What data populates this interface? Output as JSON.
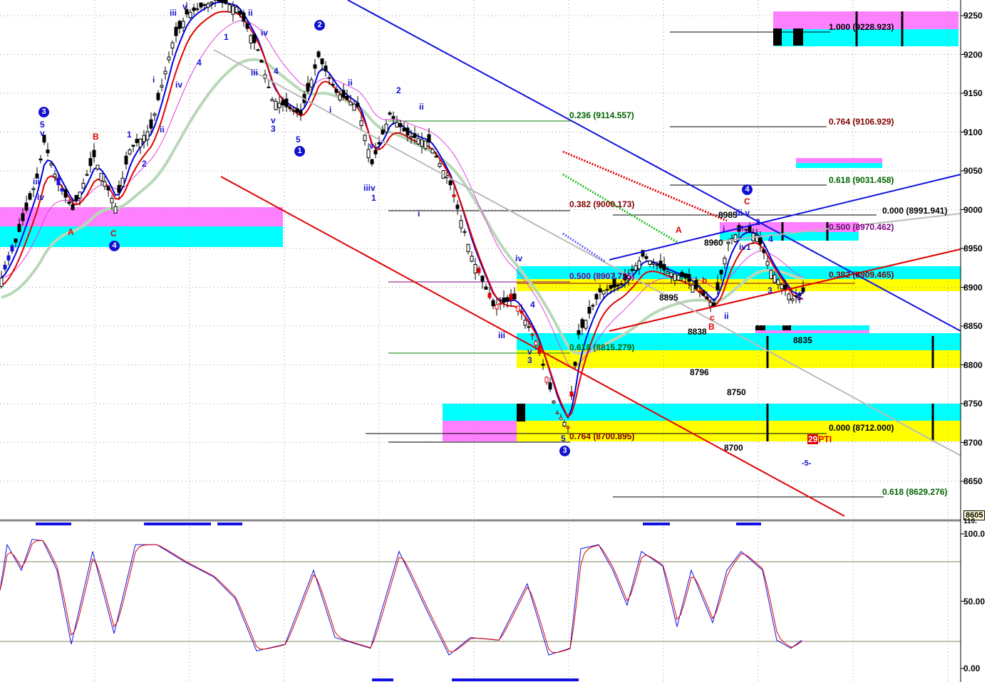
{
  "chart_data": [
    {
      "type": "line",
      "title": "Price (candlestick with Elliott wave counts and Fibonacci levels)",
      "ylim": [
        8605,
        9270
      ],
      "yticks": [
        "9250",
        "9200",
        "9150",
        "9100",
        "9050",
        "9000",
        "8950",
        "8900",
        "8850",
        "8800",
        "8750",
        "8700",
        "8650"
      ],
      "last_axis_label": "8605",
      "price": {
        "bar": [
          0,
          4,
          10,
          12,
          16,
          20,
          26,
          32,
          36,
          42,
          48,
          52,
          60,
          66,
          72,
          76,
          84,
          89,
          94,
          100,
          104,
          109,
          114,
          120,
          126,
          132,
          138,
          144,
          150,
          156,
          159,
          162,
          168,
          174,
          180,
          186,
          192,
          200,
          204,
          208,
          212,
          216,
          222,
          225
        ],
        "close": [
          8912,
          8958,
          9041,
          9087,
          9032,
          9000,
          9068,
          9004,
          9077,
          9105,
          9215,
          9252,
          9270,
          9261,
          9206,
          9142,
          9123,
          9197,
          9151,
          9133,
          9059,
          9123,
          9096,
          9087,
          9032,
          8940,
          8876,
          8885,
          8830,
          8738,
          8720,
          8839,
          8894,
          8903,
          8940,
          8922,
          8912,
          8876,
          8958,
          8977,
          8967,
          8922,
          8885,
          8894
        ]
      },
      "fib_levels": [
        {
          "text": "1.000 (9228.923)",
          "color": "#000000"
        },
        {
          "text": "0.764 (9106.929)",
          "color": "#800000"
        },
        {
          "text": "0.618 (9031.458)",
          "color": "#006400"
        },
        {
          "text": "0.000 (8991.941)",
          "color": "#000000"
        },
        {
          "text": "0.500 (8970.462)",
          "color": "#800080"
        },
        {
          "text": "0.382 (8909.465)",
          "color": "#800000"
        },
        {
          "text": "0.000 (8712.000)",
          "color": "#000000"
        },
        {
          "text": "0.618 (8629.276)",
          "color": "#006400"
        },
        {
          "text": "0.236 (9114.557)",
          "color": "#006400"
        },
        {
          "text": "0.382 (9000.173)",
          "color": "#800000"
        },
        {
          "text": "0.500 (8907.725)",
          "color": "#800080"
        },
        {
          "text": "0.618 (8815.279)",
          "color": "#006400"
        },
        {
          "text": "0.764 (8700.895)",
          "color": "#800000"
        }
      ],
      "price_labels": [
        "8985",
        "8960",
        "8895",
        "8838",
        "8835",
        "8796",
        "8750",
        "8700"
      ],
      "pti": {
        "value": "29",
        "label": "PTI"
      },
      "marker": "-5-"
    },
    {
      "type": "line",
      "title": "Stochastic oscillator",
      "ylim": [
        0,
        110
      ],
      "yticks": [
        "100.0",
        "50.00",
        "0.00"
      ],
      "top_label": "110.",
      "x": [
        0,
        2,
        6,
        9,
        12,
        16,
        20,
        26,
        32,
        38,
        44,
        52,
        60,
        66,
        72,
        80,
        88,
        94,
        104,
        112,
        120,
        126,
        132,
        140,
        148,
        154,
        160,
        163,
        168,
        172,
        176,
        180,
        186,
        190,
        194,
        200,
        204,
        208,
        214,
        218,
        222,
        225
      ],
      "k": [
        58,
        92,
        73,
        96,
        95,
        73,
        18,
        87,
        26,
        92,
        92,
        79,
        68,
        52,
        13,
        18,
        73,
        23,
        15,
        87,
        42,
        10,
        23,
        21,
        63,
        10,
        15,
        89,
        92,
        73,
        47,
        87,
        76,
        31,
        73,
        34,
        73,
        87,
        73,
        21,
        15,
        21
      ],
      "levels": [
        80,
        20
      ]
    }
  ],
  "wave_labels": [
    {
      "t": "3",
      "c": "circle"
    },
    {
      "t": "5",
      "c": "#1010d0"
    },
    {
      "t": "v",
      "c": "#1010d0"
    },
    {
      "t": "iii",
      "c": "#1010d0"
    },
    {
      "t": "iv",
      "c": "#1010d0"
    },
    {
      "t": "A",
      "c": "#e00000"
    },
    {
      "t": "B",
      "c": "#e00000"
    },
    {
      "t": "C",
      "c": "#e00000"
    },
    {
      "t": "4",
      "c": "circle"
    },
    {
      "t": "1",
      "c": "#1010d0"
    },
    {
      "t": "2",
      "c": "#1010d0"
    },
    {
      "t": "ii",
      "c": "#1010d0"
    },
    {
      "t": "i",
      "c": "#1010d0"
    },
    {
      "t": "iv",
      "c": "#1010d0"
    },
    {
      "t": "iii",
      "c": "#1010d0"
    },
    {
      "t": "v",
      "c": "#1010d0"
    },
    {
      "t": "4",
      "c": "#1010d0"
    },
    {
      "t": "1",
      "c": "#1010d0"
    },
    {
      "t": "ii",
      "c": "#1010d0"
    },
    {
      "t": "iv",
      "c": "#1010d0"
    },
    {
      "t": "iii",
      "c": "#1010d0"
    },
    {
      "t": "4",
      "c": "#1010d0"
    },
    {
      "t": "v",
      "c": "#1010d0"
    },
    {
      "t": "3",
      "c": "#1010d0"
    },
    {
      "t": "5",
      "c": "#1010d0"
    },
    {
      "t": "1",
      "c": "circle"
    },
    {
      "t": "2",
      "c": "circle"
    },
    {
      "t": "ii",
      "c": "#1010d0"
    },
    {
      "t": "i",
      "c": "#1010d0"
    },
    {
      "t": "2",
      "c": "#1010d0"
    },
    {
      "t": "ii",
      "c": "#1010d0"
    },
    {
      "t": "v",
      "c": "#1010d0"
    },
    {
      "t": "iiiv",
      "c": "#1010d0"
    },
    {
      "t": "1",
      "c": "#1010d0"
    },
    {
      "t": "i",
      "c": "#1010d0"
    },
    {
      "t": "iii",
      "c": "#1010d0"
    },
    {
      "t": "iv",
      "c": "#1010d0"
    },
    {
      "t": "4",
      "c": "#1010d0"
    },
    {
      "t": "v",
      "c": "#1010d0"
    },
    {
      "t": "3",
      "c": "#1010d0"
    },
    {
      "t": "5",
      "c": "#1010d0"
    },
    {
      "t": "3",
      "c": "circle"
    },
    {
      "t": "A",
      "c": "#e00000"
    },
    {
      "t": "a",
      "c": "#e00000"
    },
    {
      "t": "b",
      "c": "#e00000"
    },
    {
      "t": "c",
      "c": "#e00000"
    },
    {
      "t": "B",
      "c": "#e00000"
    },
    {
      "t": "ii",
      "c": "#1010d0"
    },
    {
      "t": "i",
      "c": "#1010d0"
    },
    {
      "t": "iii v",
      "c": "#1010d0"
    },
    {
      "t": "iv1",
      "c": "#1010d0"
    },
    {
      "t": "2",
      "c": "#1010d0"
    },
    {
      "t": "3",
      "c": "#1010d0"
    },
    {
      "t": "4",
      "c": "#1010d0"
    },
    {
      "t": "5",
      "c": "#1010d0"
    },
    {
      "t": "C",
      "c": "#e00000"
    },
    {
      "t": "4",
      "c": "circle"
    }
  ],
  "colors": {
    "cyan": "#00ffff",
    "yellow": "#ffff00",
    "pink": "#ff80ff",
    "fast_ma": "#e00000",
    "slow_ma": "#0000e0",
    "long_ma": "#e040e0",
    "trend_ma": "#b8d8b8"
  }
}
